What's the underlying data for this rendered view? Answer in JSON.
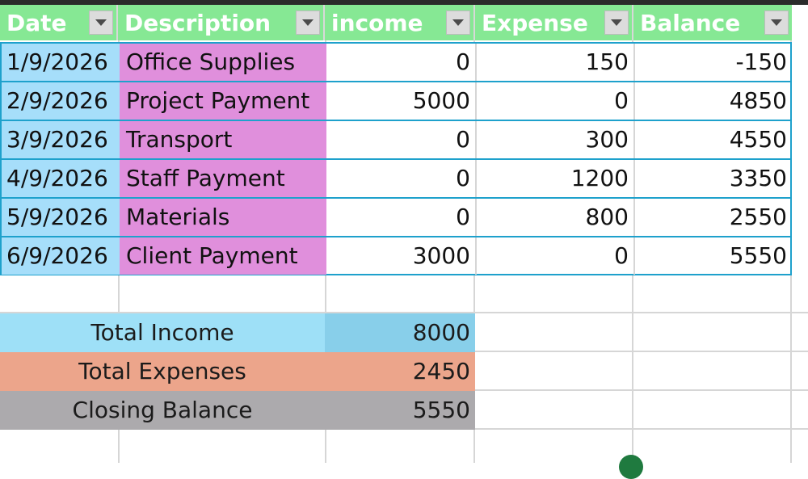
{
  "colors": {
    "header_bg": "#86e894",
    "date_bg": "#a6defa",
    "description_bg": "#e08fdc",
    "table_border": "#1ea1cc",
    "total_income_label_bg": "#9ee0f7",
    "total_income_value_bg": "#88cfea",
    "total_expenses_bg": "#eca58b",
    "closing_balance_bg": "#acaaad"
  },
  "header": {
    "date": "Date",
    "description": "Description",
    "income": "income",
    "expense": "Expense",
    "balance": "Balance",
    "filter_icon": "dropdown-arrow-icon"
  },
  "rows": [
    {
      "date": "1/9/2026",
      "description": "Office Supplies",
      "income": "0",
      "expense": "150",
      "balance": "-150"
    },
    {
      "date": "2/9/2026",
      "description": "Project Payment",
      "income": "5000",
      "expense": "0",
      "balance": "4850"
    },
    {
      "date": "3/9/2026",
      "description": "Transport",
      "income": "0",
      "expense": "300",
      "balance": "4550"
    },
    {
      "date": "4/9/2026",
      "description": "Staff Payment",
      "income": "0",
      "expense": "1200",
      "balance": "3350"
    },
    {
      "date": "5/9/2026",
      "description": "Materials",
      "income": "0",
      "expense": "800",
      "balance": "2550"
    },
    {
      "date": "6/9/2026",
      "description": "Client Payment",
      "income": "3000",
      "expense": "0",
      "balance": "5550"
    }
  ],
  "summary": {
    "total_income_label": "Total Income",
    "total_income_value": "8000",
    "total_expenses_label": "Total Expenses",
    "total_expenses_value": "2450",
    "closing_balance_label": "Closing Balance",
    "closing_balance_value": "5550"
  }
}
